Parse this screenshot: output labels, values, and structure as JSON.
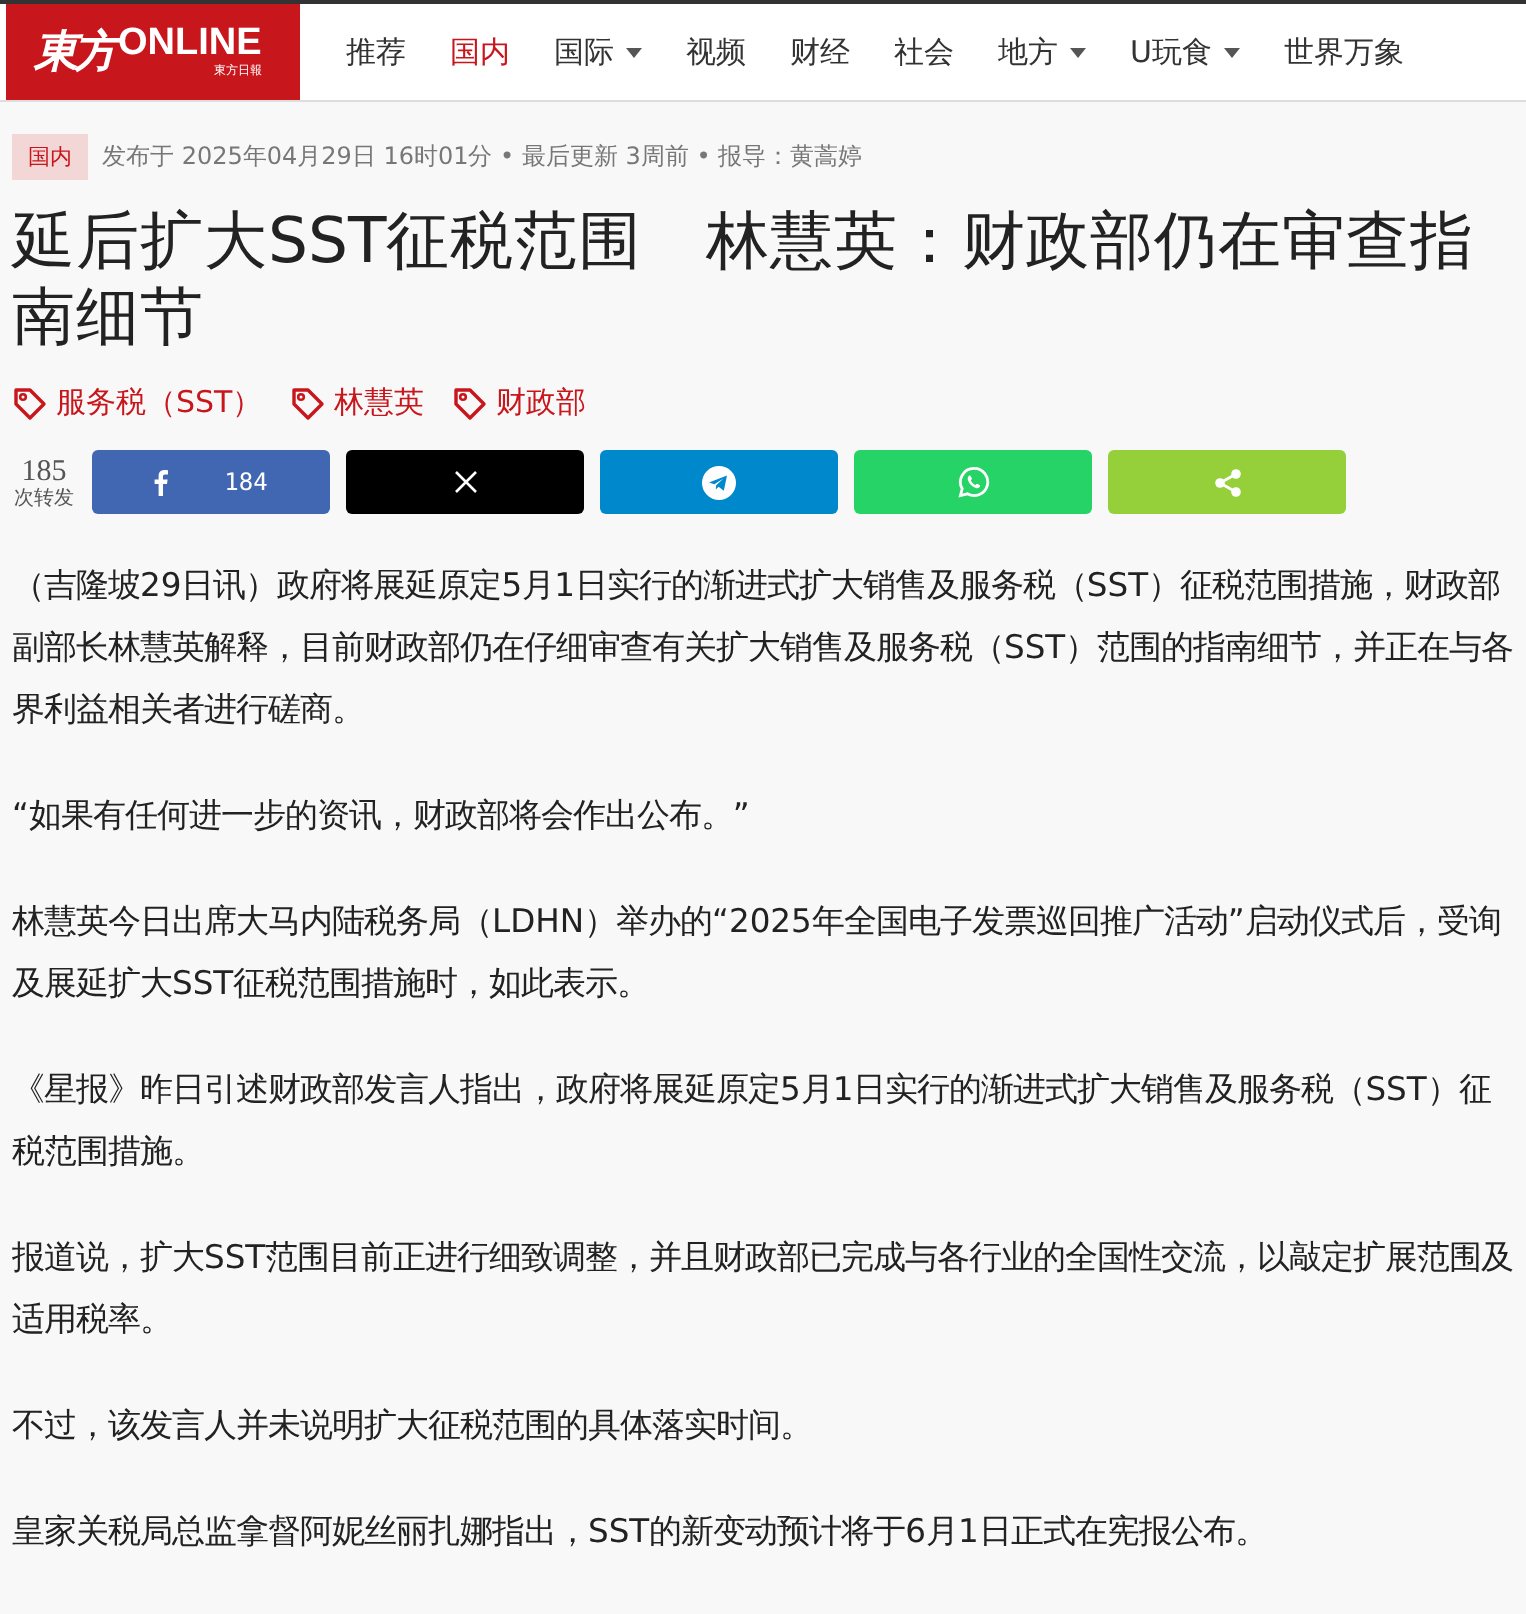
{
  "logo": {
    "main": "東方",
    "latin": "ONLINE",
    "sub": "東方日報"
  },
  "nav": [
    {
      "label": "推荐",
      "selected": false,
      "dropdown": false
    },
    {
      "label": "国内",
      "selected": true,
      "dropdown": false
    },
    {
      "label": "国际",
      "selected": false,
      "dropdown": true
    },
    {
      "label": "视频",
      "selected": false,
      "dropdown": false
    },
    {
      "label": "财经",
      "selected": false,
      "dropdown": false
    },
    {
      "label": "社会",
      "selected": false,
      "dropdown": false
    },
    {
      "label": "地方",
      "selected": false,
      "dropdown": true
    },
    {
      "label": "U玩食",
      "selected": false,
      "dropdown": true
    },
    {
      "label": "世界万象",
      "selected": false,
      "dropdown": false
    }
  ],
  "meta": {
    "category": "国内",
    "info": "发布于 2025年04月29日 16时01分 • 最后更新 3周前 • 报导：黄蒿婷"
  },
  "title": "延后扩大SST征税范围　林慧英：财政部仍在审查指南细节",
  "tags": [
    "服务税（SST）",
    "林慧英",
    "财政部"
  ],
  "share": {
    "count": "185",
    "count_label": "次转发",
    "buttons": [
      {
        "kind": "facebook",
        "count": "184"
      },
      {
        "kind": "x"
      },
      {
        "kind": "telegram"
      },
      {
        "kind": "whatsapp"
      },
      {
        "kind": "share"
      }
    ]
  },
  "paragraphs": [
    "（吉隆坡29日讯）政府将展延原定5月1日实行的渐进式扩大销售及服务税（SST）征税范围措施，财政部副部长林慧英解释，目前财政部仍在仔细审查有关扩大销售及服务税（SST）范围的指南细节，并正在与各界利益相关者进行磋商。",
    "“如果有任何进一步的资讯，财政部将会作出公布。”",
    "林慧英今日出席大马内陆税务局（LDHN）举办的“2025年全国电子发票巡回推广活动”启动仪式后，受询及展延扩大SST征税范围措施时，如此表示。",
    "《星报》昨日引述财政部发言人指出，政府将展延原定5月1日实行的渐进式扩大销售及服务税（SST）征税范围措施。",
    "报道说，扩大SST范围目前正进行细致调整，并且财政部已完成与各行业的全国性交流，以敲定扩展范围及适用税率。",
    "不过，该发言人并未说明扩大征税范围的具体落实时间。",
    "皇家关税局总监拿督阿妮丝丽扎娜指出，SST的新变动预计将于6月1日正式在宪报公布。"
  ]
}
